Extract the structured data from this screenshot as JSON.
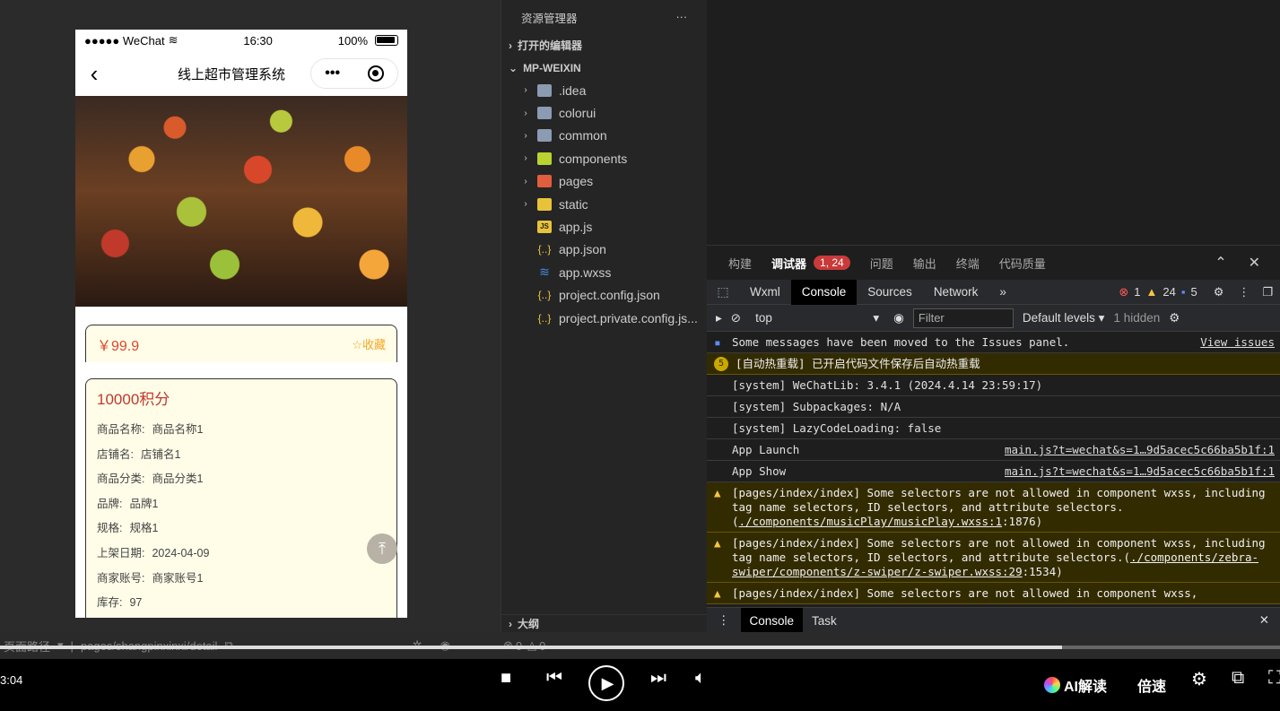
{
  "phone": {
    "status": {
      "carrier": "●●●●● WeChat",
      "time": "16:30",
      "battery": "100%"
    },
    "nav": {
      "title": "线上超市管理系统"
    },
    "price": "￥99.9",
    "fav_label": "收藏",
    "points": "10000积分",
    "fields": [
      {
        "k": "商品名称:",
        "v": "商品名称1"
      },
      {
        "k": "店铺名:",
        "v": "店铺名1"
      },
      {
        "k": "商品分类:",
        "v": "商品分类1"
      },
      {
        "k": "品牌:",
        "v": "品牌1"
      },
      {
        "k": "规格:",
        "v": "规格1"
      },
      {
        "k": "上架日期:",
        "v": "2024-04-09"
      },
      {
        "k": "商家账号:",
        "v": "商家账号1"
      },
      {
        "k": "库存:",
        "v": "97"
      }
    ]
  },
  "explorer": {
    "title": "资源管理器",
    "more": "···",
    "open_editors": "打开的编辑器",
    "project": "MP-WEIXIN",
    "items": [
      {
        "label": ".idea",
        "icon": "folder-icon"
      },
      {
        "label": "colorui",
        "icon": "folder-icon"
      },
      {
        "label": "common",
        "icon": "folder-icon"
      },
      {
        "label": "components",
        "icon": "components-folder-icon"
      },
      {
        "label": "pages",
        "icon": "pages-folder-icon"
      },
      {
        "label": "static",
        "icon": "static-folder-icon"
      },
      {
        "label": "app.js",
        "icon": "js-file-icon"
      },
      {
        "label": "app.json",
        "icon": "json-file-icon"
      },
      {
        "label": "app.wxss",
        "icon": "css-file-icon"
      },
      {
        "label": "project.config.json",
        "icon": "json-file-icon"
      },
      {
        "label": "project.private.config.js...",
        "icon": "json-file-icon"
      }
    ],
    "outline": "大纲"
  },
  "debug": {
    "tabs": [
      "构建",
      "调试器",
      "问题",
      "输出",
      "终端",
      "代码质量"
    ],
    "badge": "1, 24",
    "devtools_tabs": [
      "Wxml",
      "Console",
      "Sources",
      "Network"
    ],
    "more_tabs": "»",
    "counts": {
      "errors": "1",
      "warnings": "24",
      "info": "5"
    },
    "context": "top",
    "filter_placeholder": "Filter",
    "levels": "Default levels",
    "hidden": "1 hidden",
    "messages": [
      {
        "text": "Some messages have been moved to the Issues panel.",
        "src": "View issues"
      },
      {
        "badge": "5",
        "text": "[自动热重载] 已开启代码文件保存后自动热重载"
      },
      {
        "text": "[system] WeChatLib: 3.4.1 (2024.4.14 23:59:17)"
      },
      {
        "text": "[system] Subpackages: N/A"
      },
      {
        "text": "[system] LazyCodeLoading: false"
      },
      {
        "text": "App Launch",
        "src": "main.js?t=wechat&s=1…9d5acec5c66ba5b1f:1"
      },
      {
        "text": "App Show",
        "src": "main.js?t=wechat&s=1…9d5acec5c66ba5b1f:1"
      },
      {
        "pre": "[pages/index/index] Some selectors are not allowed in component wxss, including tag name selectors, ID selectors, and attribute selectors.(",
        "link": "./components/musicPlay/musicPlay.wxss:1",
        "post": ":1876)"
      },
      {
        "pre": "[pages/index/index] Some selectors are not allowed in component wxss, including tag name selectors, ID selectors, and attribute selectors.(",
        "link": "./components/zebra-swiper/components/z-swiper/z-swiper.wxss:29",
        "post": ":1534)"
      },
      {
        "pre": "[pages/index/index] Some selectors are not allowed in component wxss,",
        "link": "",
        "post": ""
      }
    ],
    "drawer_tabs": [
      "Console",
      "Task"
    ]
  },
  "statusbar": {
    "route_label": "页面路径",
    "path": "pages/shangpinxinxi/detail",
    "errors": "0",
    "warnings": "0"
  },
  "player": {
    "time": "3:04",
    "ai_label": "AI解读",
    "speed_label": "倍速",
    "progress": 0.83
  }
}
